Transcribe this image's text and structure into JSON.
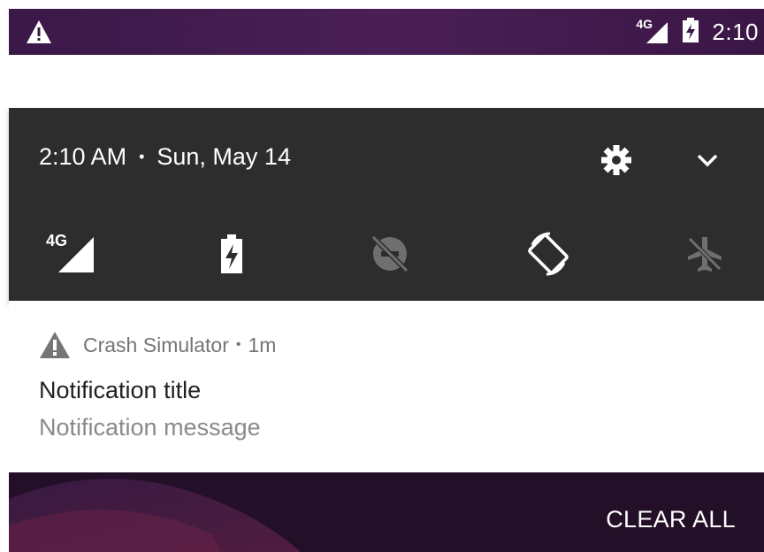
{
  "status_bar": {
    "network": "4G",
    "time": "2:10",
    "icons": [
      "warning-icon",
      "4g-signal-icon",
      "battery-charging-icon"
    ]
  },
  "shade": {
    "time": "2:10 AM",
    "separator": "•",
    "date": "Sun, May 14",
    "icons": [
      "settings-gear-icon",
      "chevron-down-icon"
    ],
    "quick_settings": [
      {
        "name": "mobile-data",
        "label": "4G",
        "icon": "4g-signal-icon",
        "active": true
      },
      {
        "name": "battery",
        "icon": "battery-charging-icon",
        "active": true
      },
      {
        "name": "data-saver",
        "icon": "data-saver-off-icon",
        "active": false
      },
      {
        "name": "auto-rotate",
        "icon": "auto-rotate-icon",
        "active": true
      },
      {
        "name": "airplane-mode",
        "icon": "airplane-off-icon",
        "active": false
      }
    ]
  },
  "notification": {
    "app_name": "Crash Simulator",
    "separator": "•",
    "time_ago": "1m",
    "title": "Notification title",
    "message": "Notification message",
    "icon": "warning-icon"
  },
  "footer": {
    "clear_all_label": "CLEAR ALL"
  },
  "colors": {
    "status_bar": "#3a1848",
    "shade": "#2d2d2d",
    "footer": "#231028",
    "inactive_icon": "#6f6f6f"
  }
}
